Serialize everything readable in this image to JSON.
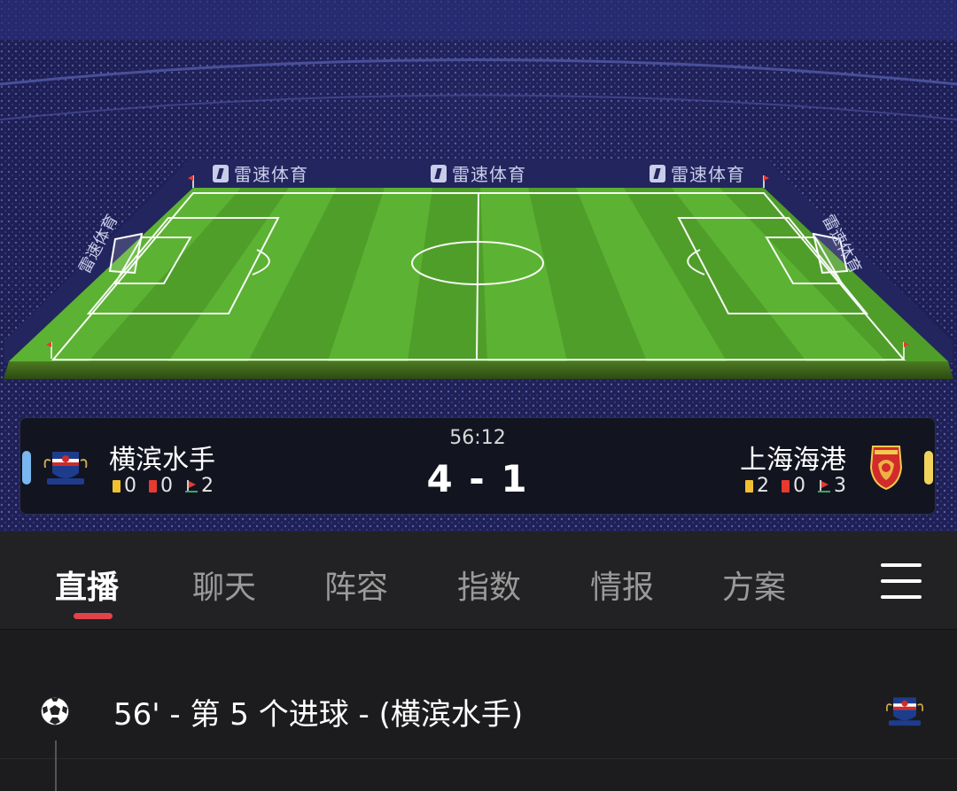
{
  "stadium": {
    "ads": [
      "雷速体育",
      "雷速体育",
      "雷速体育"
    ],
    "side_ads": [
      "雷速体育",
      "雷速体育"
    ]
  },
  "match": {
    "time": "56:12",
    "score": "4 - 1",
    "home": {
      "name": "横滨水手",
      "yellow": "0",
      "red": "0",
      "corners": "2",
      "accent": "#79b7f0"
    },
    "away": {
      "name": "上海海港",
      "yellow": "2",
      "red": "0",
      "corners": "3",
      "accent": "#f0d35c"
    }
  },
  "tabs": [
    "直播",
    "聊天",
    "阵容",
    "指数",
    "情报",
    "方案"
  ],
  "active_tab": "直播",
  "feed": {
    "events": [
      {
        "text": "56' - 第 5 个进球 - (横滨水手)",
        "icon": "soccer-ball-icon"
      }
    ]
  },
  "colors": {
    "tab_indicator": "#e0444a",
    "yellow_card": "#f0c030",
    "red_card": "#e83a2f"
  }
}
